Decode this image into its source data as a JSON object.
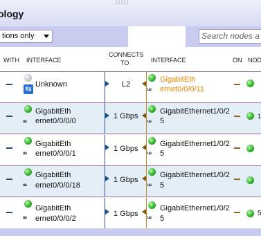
{
  "panel": {
    "title": "ology"
  },
  "toolbar": {
    "filter_value": "tions only",
    "search_placeholder": "Search nodes a"
  },
  "columns": {
    "with": "WITH",
    "interface": "INTERFACE",
    "connects_to_1": "CONNECTS",
    "connects_to_2": "TO",
    "interface2": "INTERFACE",
    "on": "ON",
    "node": "NOD"
  },
  "rows": [
    {
      "local_if_1": "",
      "local_if_2": "Unknown",
      "speed": "L2",
      "remote_if_1": "GigabitEth",
      "remote_if_2": "ernet0/0/0/11",
      "remote_orange": true,
      "local_status": "grey",
      "extra": ""
    },
    {
      "local_if_1": "GigabitEth",
      "local_if_2": "ernet0/0/0/0",
      "speed": "1 Gbps",
      "remote_if_1": "GigabitEthernet1/0/2",
      "remote_if_2": "5",
      "remote_orange": false,
      "local_status": "green",
      "extra": "1"
    },
    {
      "local_if_1": "GigabitEth",
      "local_if_2": "ernet0/0/0/1",
      "speed": "1 Gbps",
      "remote_if_1": "GigabitEthernet1/0/2",
      "remote_if_2": "5",
      "remote_orange": false,
      "local_status": "green",
      "extra": ""
    },
    {
      "local_if_1": "GigabitEth",
      "local_if_2": "ernet0/0/0/18",
      "speed": "1 Gbps",
      "remote_if_1": "GigabitEthernet1/0/2",
      "remote_if_2": "5",
      "remote_orange": false,
      "local_status": "green",
      "extra": ""
    },
    {
      "local_if_1": "GigabitEth",
      "local_if_2": "ernet0/0/0/2",
      "speed": "1 Gbps",
      "remote_if_1": "GigabitEthernet1/0/2",
      "remote_if_2": "5",
      "remote_orange": false,
      "local_status": "green",
      "extra": "5"
    }
  ],
  "colors": {
    "header_band": "#c9ccef",
    "row_alt": "#e4eef6",
    "orange_text": "#ee8800",
    "link_blue": "#1a4f8a"
  }
}
